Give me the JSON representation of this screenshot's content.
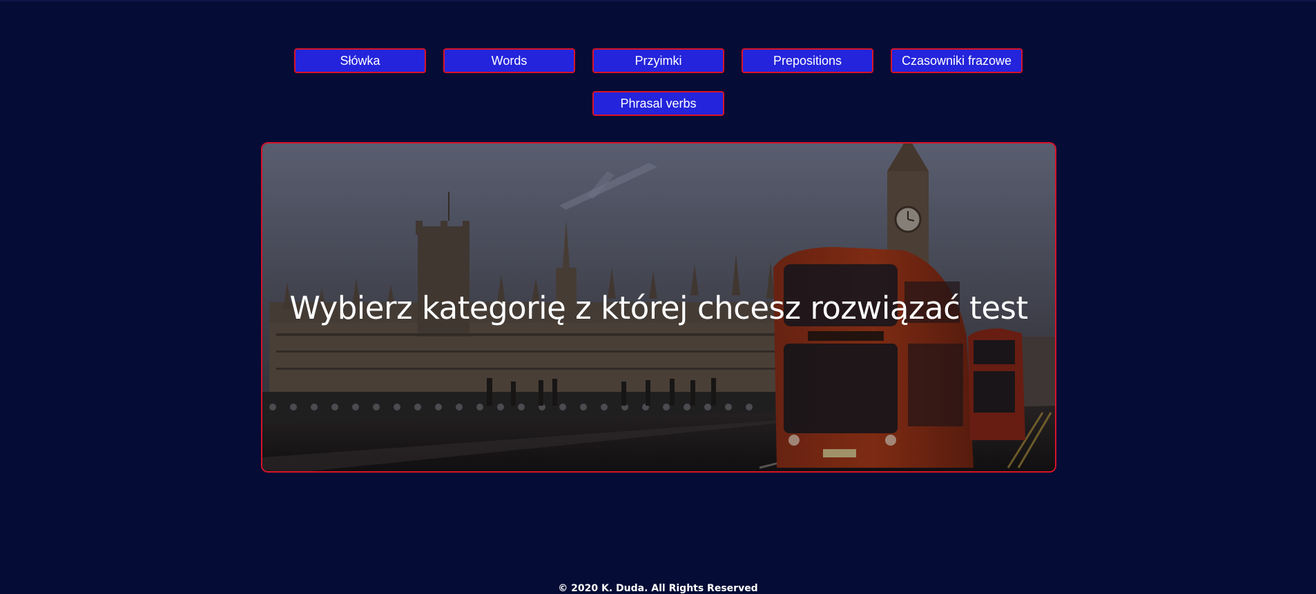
{
  "nav": {
    "buttons": [
      {
        "label": "Słówka"
      },
      {
        "label": "Words"
      },
      {
        "label": "Przyimki"
      },
      {
        "label": "Prepositions"
      },
      {
        "label": "Czasowniki frazowe"
      },
      {
        "label": "Phrasal verbs"
      }
    ]
  },
  "hero": {
    "title": "Wybierz kategorię z której chcesz rozwiązać test"
  },
  "footer": {
    "copyright": "© 2020 K. Duda. All Rights Reserved"
  },
  "colors": {
    "background": "#050c35",
    "button_fill": "#2424dc",
    "button_border": "#d81428"
  }
}
